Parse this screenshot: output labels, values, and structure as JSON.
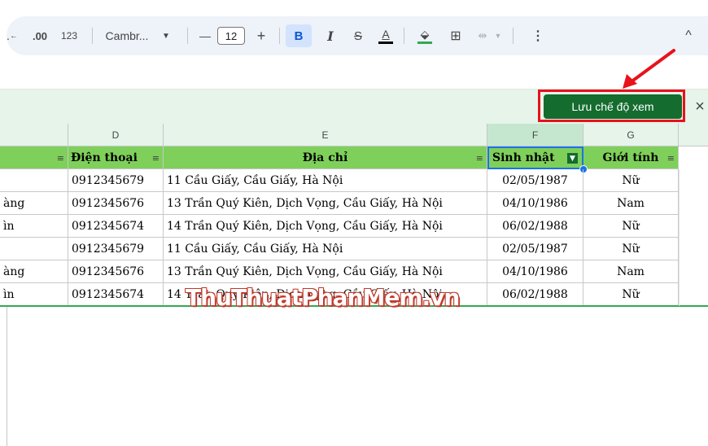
{
  "toolbar": {
    "decimal_label": ".00",
    "format_label": "123",
    "font_name": "Cambr...",
    "minus": "—",
    "font_size": "12",
    "plus": "+",
    "bold": "B",
    "italic": "I",
    "strike": "S",
    "text_color_label": "A",
    "more": "⋮",
    "collapse": "^"
  },
  "filter_view": {
    "save_label": "Lưu chế độ xem",
    "close_label": "×"
  },
  "columns": [
    "D",
    "E",
    "F",
    "G"
  ],
  "headers": {
    "c": "",
    "d": "Điện thoại",
    "e": "Địa chỉ",
    "f": "Sinh nhật",
    "g": "Giới tính"
  },
  "rows": [
    {
      "c": "",
      "d": "0912345679",
      "e": "11 Cầu Giấy, Cầu Giấy, Hà Nội",
      "f": "02/05/1987",
      "g": "Nữ"
    },
    {
      "c": "àng",
      "d": "0912345676",
      "e": "13 Trần Quý Kiên, Dịch Vọng, Cầu Giấy, Hà Nội",
      "f": "04/10/1986",
      "g": "Nam"
    },
    {
      "c": "ìn",
      "d": "0912345674",
      "e": "14 Trần Quý Kiên, Dịch Vọng, Cầu Giấy, Hà Nội",
      "f": "06/02/1988",
      "g": "Nữ"
    },
    {
      "c": "",
      "d": "0912345679",
      "e": "11 Cầu Giấy, Cầu Giấy, Hà Nội",
      "f": "02/05/1987",
      "g": "Nữ"
    },
    {
      "c": "àng",
      "d": "0912345676",
      "e": "13 Trần Quý Kiên, Dịch Vọng, Cầu Giấy, Hà Nội",
      "f": "04/10/1986",
      "g": "Nam"
    },
    {
      "c": "ìn",
      "d": "0912345674",
      "e": "14 Trần Quý Kiên, Dịch Vọng, Cầu Giấy, Hà Nội",
      "f": "06/02/1988",
      "g": "Nữ"
    }
  ],
  "watermark": "ThuThuatPhanMem.vn",
  "colors": {
    "header_green": "#7fd05a",
    "filter_bar": "#e6f4ea",
    "save_button": "#146c2e",
    "highlight_red": "#e8121a",
    "selection_blue": "#1a73e8"
  }
}
